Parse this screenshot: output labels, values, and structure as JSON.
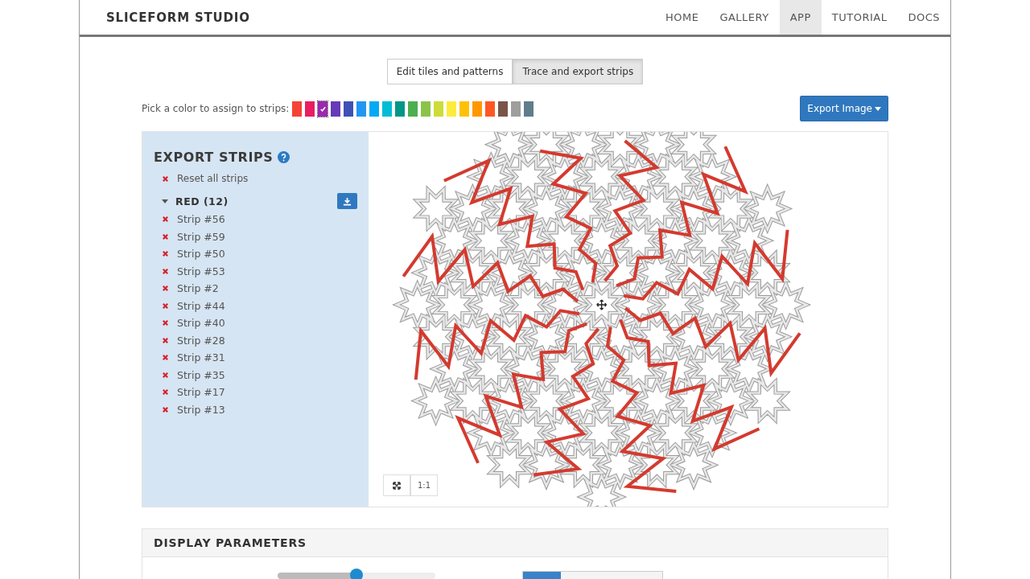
{
  "navbar": {
    "brand": "SLICEFORM STUDIO",
    "links": [
      {
        "label": "HOME",
        "selected": false
      },
      {
        "label": "GALLERY",
        "selected": false
      },
      {
        "label": "APP",
        "selected": true
      },
      {
        "label": "TUTORIAL",
        "selected": false
      },
      {
        "label": "DOCS",
        "selected": false
      }
    ]
  },
  "mode_tabs": [
    {
      "label": "Edit tiles and patterns",
      "selected": false
    },
    {
      "label": "Trace and export strips",
      "selected": true
    }
  ],
  "color_picker": {
    "label": "Pick a color to assign to strips:",
    "swatches": [
      {
        "color": "#f44336",
        "selected": false
      },
      {
        "color": "#e91e63",
        "selected": false
      },
      {
        "color": "#9c27b0",
        "selected": true
      },
      {
        "color": "#673ab7",
        "selected": false
      },
      {
        "color": "#3f51b5",
        "selected": false
      },
      {
        "color": "#2196f3",
        "selected": false
      },
      {
        "color": "#03a9f4",
        "selected": false
      },
      {
        "color": "#00bcd4",
        "selected": false
      },
      {
        "color": "#009688",
        "selected": false
      },
      {
        "color": "#4caf50",
        "selected": false
      },
      {
        "color": "#8bc34a",
        "selected": false
      },
      {
        "color": "#cddc39",
        "selected": false
      },
      {
        "color": "#ffeb3b",
        "selected": false
      },
      {
        "color": "#ffc107",
        "selected": false
      },
      {
        "color": "#ff9800",
        "selected": false
      },
      {
        "color": "#ff5722",
        "selected": false
      },
      {
        "color": "#795548",
        "selected": false
      },
      {
        "color": "#9e9e9e",
        "selected": false
      },
      {
        "color": "#607d8b",
        "selected": false
      }
    ]
  },
  "export_button": "Export Image",
  "sidebar": {
    "title": "EXPORT STRIPS",
    "reset": "Reset all strips",
    "groups": [
      {
        "label": "RED (12)",
        "expanded": true,
        "children": [
          {
            "label": "Strip #56"
          },
          {
            "label": "Strip #59"
          },
          {
            "label": "Strip #50"
          },
          {
            "label": "Strip #53"
          },
          {
            "label": "Strip #2"
          },
          {
            "label": "Strip #44"
          },
          {
            "label": "Strip #40"
          },
          {
            "label": "Strip #28"
          },
          {
            "label": "Strip #31"
          },
          {
            "label": "Strip #35"
          },
          {
            "label": "Strip #17"
          },
          {
            "label": "Strip #13"
          }
        ]
      }
    ]
  },
  "canvas": {
    "zoom_reset": "1:1"
  },
  "display_parameters": {
    "title": "DISPLAY PARAMETERS",
    "slider": {
      "level": 0.5
    },
    "toggle": [
      {
        "selected": true
      },
      {
        "selected": false
      }
    ]
  }
}
